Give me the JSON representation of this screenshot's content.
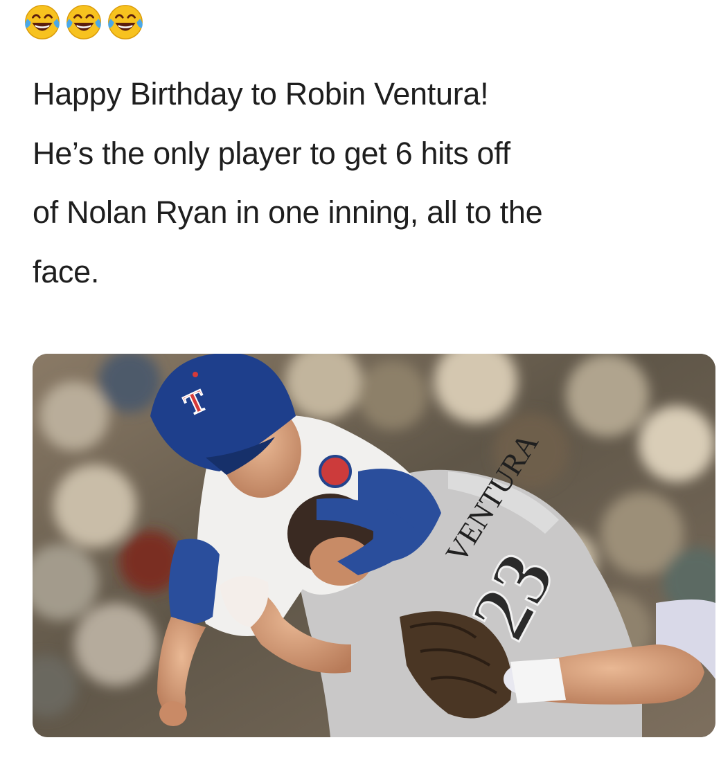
{
  "emojis": {
    "icon": "face-with-tears-of-joy-icon",
    "count": 3,
    "colors": {
      "face": "#f7c21f",
      "mouth": "#5a1e0e",
      "tears": "#4aa8e8"
    }
  },
  "caption": {
    "lines": [
      "Happy Birthday to Robin Ventura!",
      "He’s the only player to get 6 hits off",
      "of Nolan Ryan in one inning, all to the",
      "face."
    ]
  },
  "photo": {
    "cap_letter": "T",
    "jersey_name": "VENTURA",
    "jersey_number": "23"
  }
}
